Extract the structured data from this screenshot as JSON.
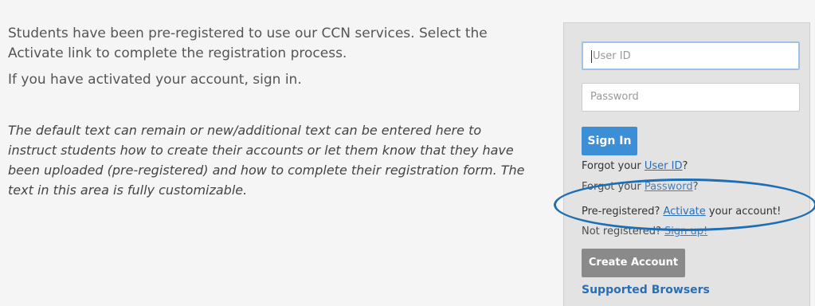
{
  "intro": {
    "line1": "Students have been pre-registered to use our CCN services. Select the Activate link to complete the registration process.",
    "line2": "If you have activated your account, sign in.",
    "custom": "The default text can remain or new/additional text can be entered here to instruct students how to create their accounts or let them know that they have been uploaded (pre-registered) and how to complete their registration form. The text in this area is fully customizable."
  },
  "login": {
    "userid_placeholder": "User ID",
    "password_placeholder": "Password",
    "signin_label": "Sign In",
    "forgot_prefix": "Forgot your ",
    "forgot_userid_link": "User ID",
    "forgot_userid_suffix": "?",
    "forgot_password_link": "Password",
    "forgot_password_suffix": "?",
    "prereg_prefix": "Pre-registered? ",
    "activate_link": "Activate",
    "prereg_suffix": " your account!",
    "notreg_prefix": "Not registered? ",
    "signup_link": "Sign up!",
    "create_account_label": "Create Account",
    "supported_browsers": "Supported Browsers"
  },
  "colors": {
    "accent_blue": "#3c8fd6",
    "link_blue": "#2a6fb5",
    "annotation_ellipse": "#1e6eb4"
  }
}
